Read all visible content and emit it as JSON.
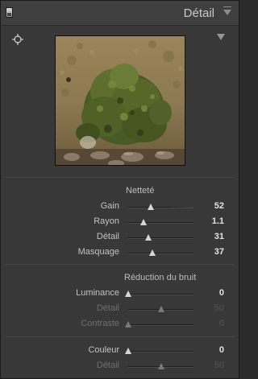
{
  "header": {
    "title": "Détail"
  },
  "sharpening": {
    "title": "Netteté",
    "rows": [
      {
        "label": "Gain",
        "value": "52",
        "fraction": 0.35,
        "dim": false,
        "red": true
      },
      {
        "label": "Rayon",
        "value": "1.1",
        "fraction": 0.24,
        "dim": false,
        "red": false
      },
      {
        "label": "Détail",
        "value": "31",
        "fraction": 0.31,
        "dim": false,
        "red": false
      },
      {
        "label": "Masquage",
        "value": "37",
        "fraction": 0.37,
        "dim": false,
        "red": false
      }
    ]
  },
  "noise": {
    "title": "Réduction du bruit",
    "luminance_rows": [
      {
        "label": "Luminance",
        "value": "0",
        "fraction": 0.0,
        "dim": false
      },
      {
        "label": "Détail",
        "value": "50",
        "fraction": 0.5,
        "dim": true
      },
      {
        "label": "Contraste",
        "value": "0",
        "fraction": 0.0,
        "dim": true
      }
    ],
    "color_rows": [
      {
        "label": "Couleur",
        "value": "0",
        "fraction": 0.0,
        "dim": false
      },
      {
        "label": "Détail",
        "value": "50",
        "fraction": 0.5,
        "dim": true
      }
    ]
  }
}
